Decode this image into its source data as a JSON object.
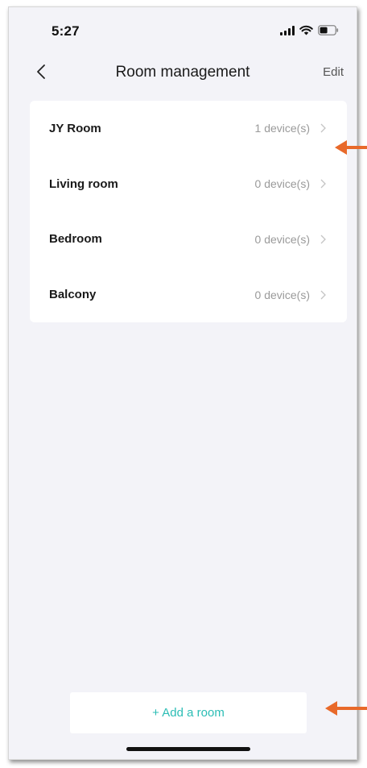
{
  "status_bar": {
    "time": "5:27"
  },
  "header": {
    "title": "Room management",
    "edit_label": "Edit",
    "back_icon": "chevron-left-icon"
  },
  "rooms": [
    {
      "name": "JY Room",
      "count": "1 device(s)"
    },
    {
      "name": "Living room",
      "count": "0 device(s)"
    },
    {
      "name": "Bedroom",
      "count": "0 device(s)"
    },
    {
      "name": "Balcony",
      "count": "0 device(s)"
    }
  ],
  "add_room": {
    "label": "+ Add a room"
  },
  "colors": {
    "background": "#f3f3f8",
    "card": "#ffffff",
    "accent": "#2bbdb5",
    "annotation_arrow": "#e8692a"
  }
}
